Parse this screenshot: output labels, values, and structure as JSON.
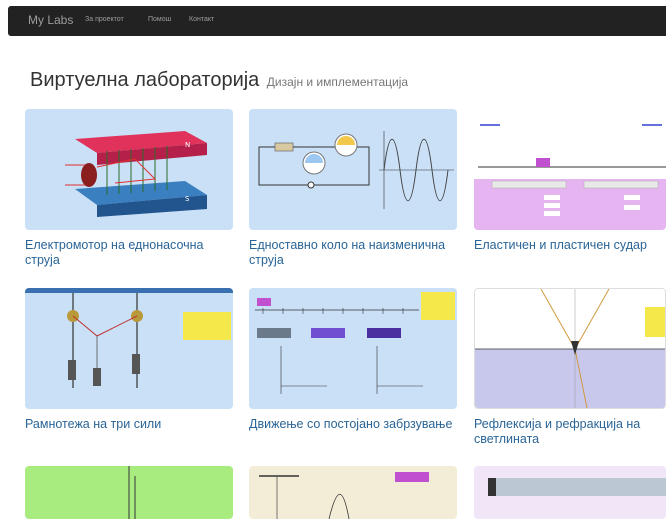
{
  "navbar": {
    "brand": "My Labs",
    "links": [
      "За проектот",
      "Помош",
      "Контакт"
    ]
  },
  "page": {
    "title": "Виртуелна лабораторија",
    "subtitle": "Дизајн и имплементација"
  },
  "cards": [
    {
      "caption": "Електромотор на еднонасочна струја"
    },
    {
      "caption": "Едноставно коло на наизменична струја"
    },
    {
      "caption": "Еластичен и пластичен судар"
    },
    {
      "caption": "Рамнотежа на три сили"
    },
    {
      "caption": "Движење со постојано забрзување"
    },
    {
      "caption": "Рефлексија и рефракција на светлината"
    }
  ],
  "colors": {
    "navbar_bg": "#222222",
    "link": "#2a6496",
    "thumb_bg": "#c9e0f7"
  }
}
